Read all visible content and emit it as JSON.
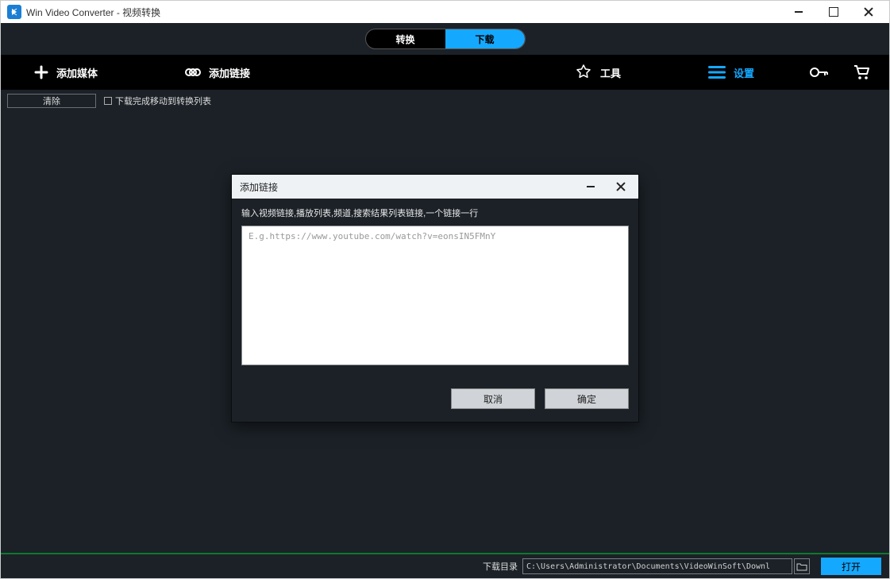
{
  "window": {
    "title": "Win Video Converter - 视频转换"
  },
  "tabs": {
    "convert": "转换",
    "download": "下载"
  },
  "toolbar": {
    "add_media": "添加媒体",
    "add_link": "添加链接",
    "tools": "工具",
    "settings": "设置"
  },
  "subbar": {
    "clear": "清除",
    "move_after_download": "下载完成移动到转换列表"
  },
  "dialog": {
    "title": "添加链接",
    "hint": "输入视频链接,播放列表,频道,搜索结果列表链接,一个链接一行",
    "placeholder": "E.g.https://www.youtube.com/watch?v=eonsIN5FMnY",
    "cancel": "取消",
    "ok": "确定"
  },
  "bottom": {
    "label": "下载目录",
    "path": "C:\\Users\\Administrator\\Documents\\VideoWinSoft\\Downl",
    "open": "打开"
  }
}
